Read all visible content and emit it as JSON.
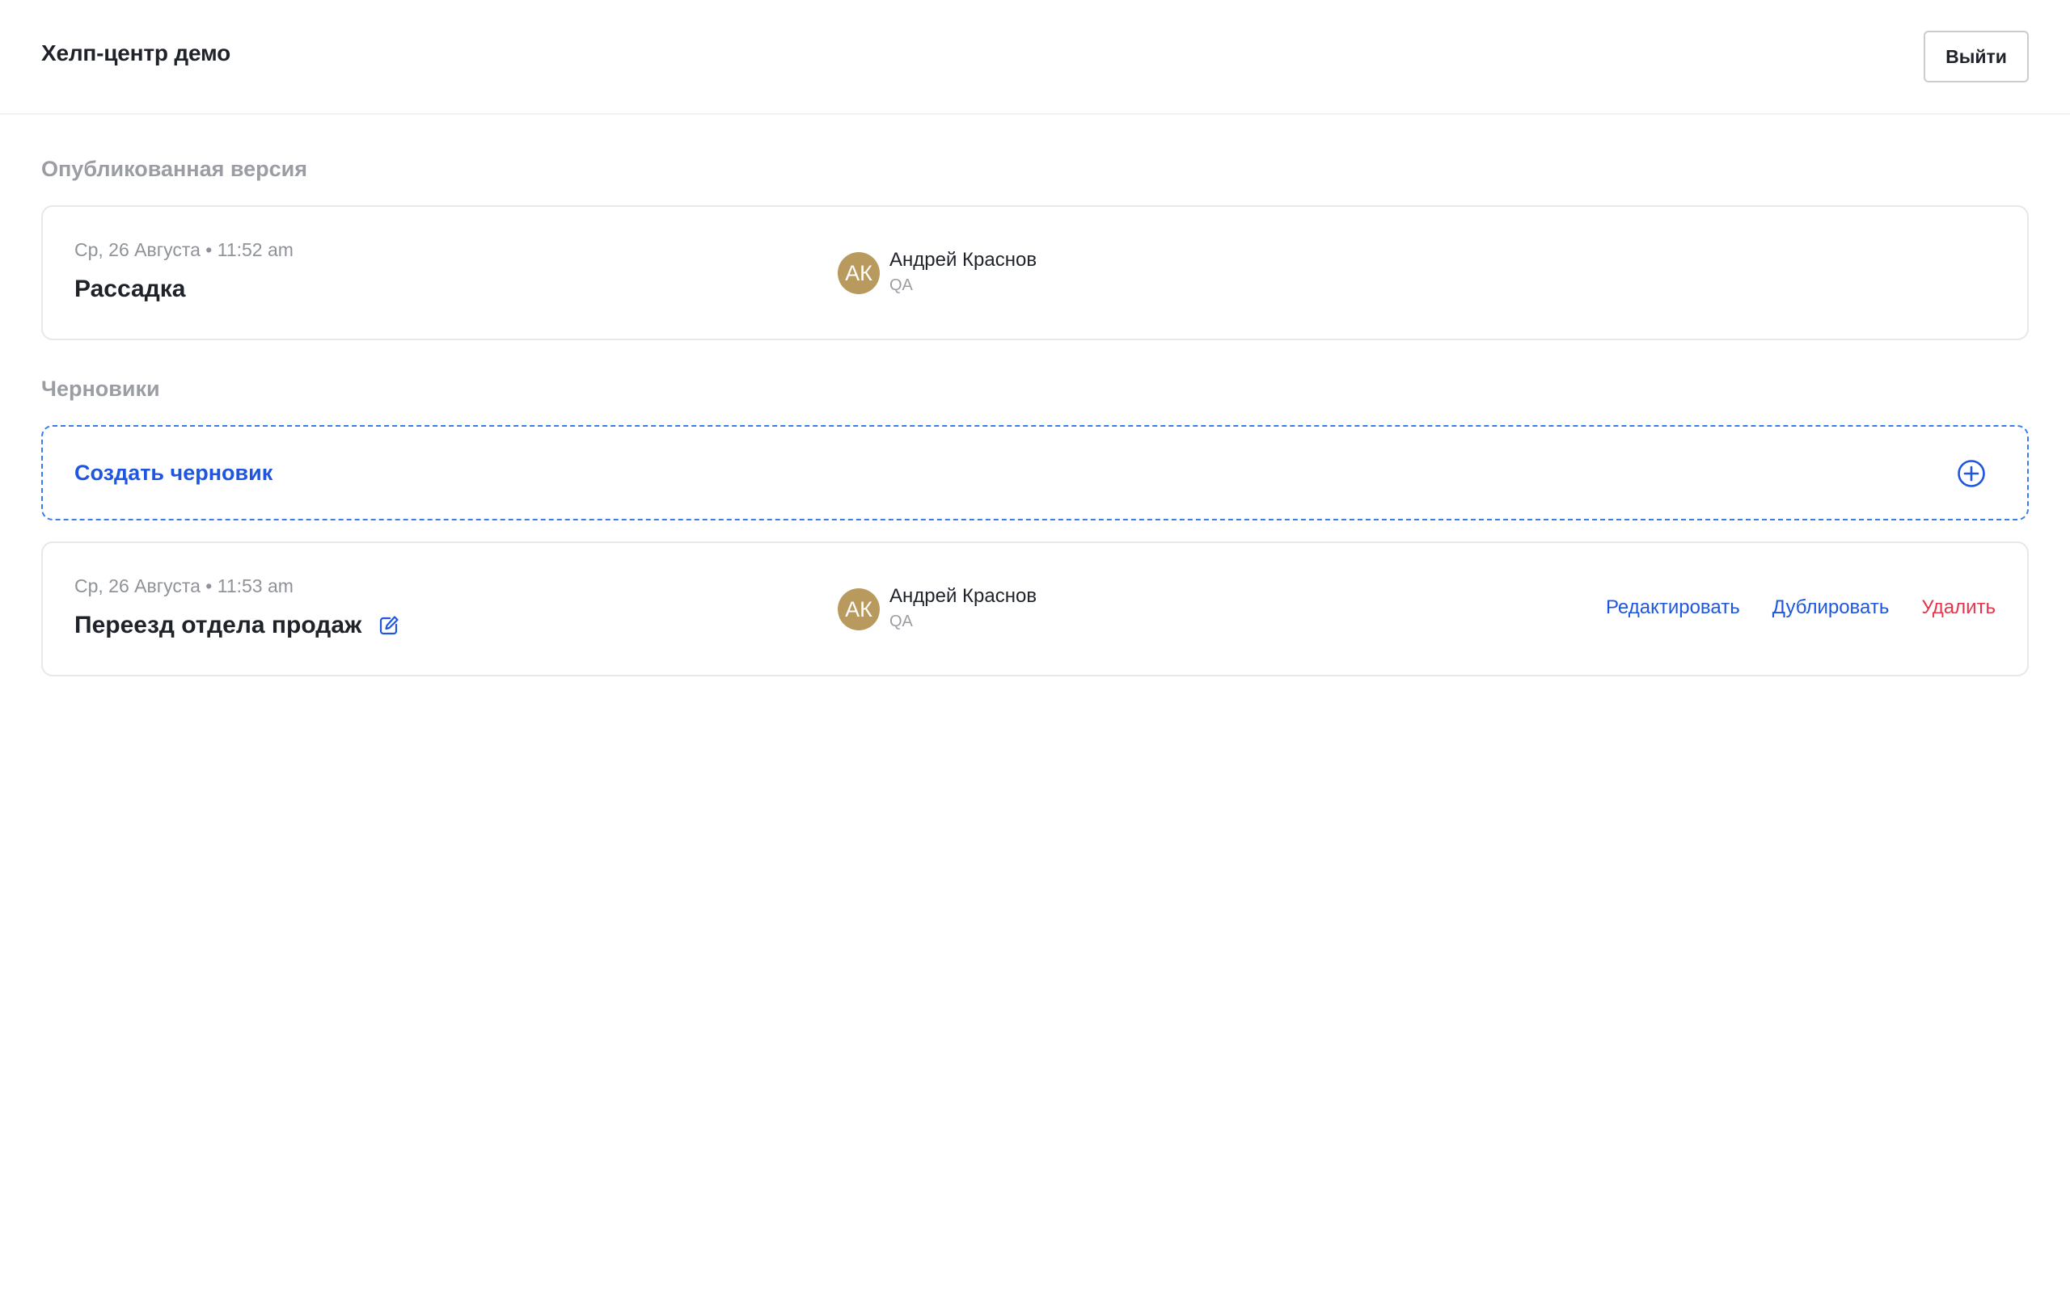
{
  "header": {
    "title": "Хелп-центр демо",
    "logout_label": "Выйти"
  },
  "published": {
    "heading": "Опубликованная версия",
    "item": {
      "date": "Ср, 26 Августа • 11:52 am",
      "title": "Рассадка",
      "author": {
        "initials": "АК",
        "name": "Андрей Краснов",
        "role": "QA",
        "avatar_color": "#b89a5e"
      }
    }
  },
  "drafts": {
    "heading": "Черновики",
    "create_label": "Создать черновик",
    "create_icon": "plus-circle-icon",
    "items": [
      {
        "date": "Ср, 26 Августа • 11:53 am",
        "title": "Переезд отдела продаж",
        "title_icon": "edit-icon",
        "author": {
          "initials": "АК",
          "name": "Андрей Краснов",
          "role": "QA",
          "avatar_color": "#b89a5e"
        },
        "actions": {
          "edit": "Редактировать",
          "duplicate": "Дублировать",
          "delete": "Удалить"
        }
      }
    ]
  },
  "colors": {
    "accent": "#1f56e0",
    "danger": "#e8344a",
    "muted_text": "#9a9da3",
    "border": "#e6e8eb"
  }
}
